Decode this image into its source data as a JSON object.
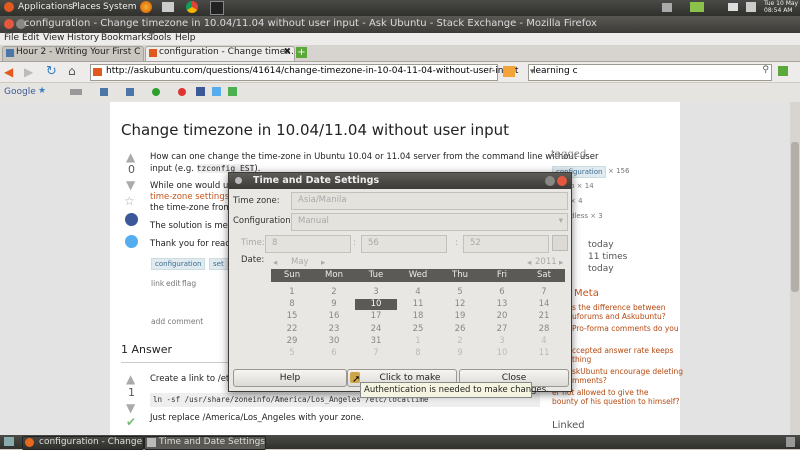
{
  "top_panel": {
    "applications": "Applications",
    "places": "Places",
    "system": "System",
    "clock_date": "Tue 10 May",
    "clock_time": "08:54 AM"
  },
  "firefox": {
    "title": "configuration - Change timezone in 10.04/11.04 without user input - Ask Ubuntu - Stack Exchange - Mozilla Firefox",
    "menu": [
      "File",
      "Edit",
      "View",
      "History",
      "Bookmarks",
      "Tools",
      "Help"
    ],
    "tabs": [
      {
        "label": "Hour 2 - Writing Your First C ..."
      },
      {
        "label": "configuration - Change time..."
      }
    ],
    "url": "http://askubuntu.com/questions/41614/change-timezone-in-10-04-11-04-without-user-input",
    "search_value": "learning c",
    "toolbar2_google": "Google"
  },
  "question": {
    "title": "Change timezone in 10.04/11.04 without user input",
    "vote_count": "0",
    "body_line1": "How can one change the time-zone in Ubuntu 10.04 or 11.04 server from the command line without user",
    "body_line2_prefix": "input (e.g.",
    "body_code": "tzconfig EST",
    "body_line2_suffix": ").",
    "body_p2_line1": "While one would use",
    "body_p2_link": "time-zone settings f",
    "body_p2_line3": "the time-zone from w",
    "body_p3": "The solution is mean",
    "body_p4": "Thank you for reading",
    "tags": [
      "configuration",
      "set"
    ],
    "actions": [
      "link",
      "edit",
      "flag"
    ],
    "add_comment": "add comment"
  },
  "answers": {
    "heading": "1 Answer",
    "vote_count": "1",
    "text1": "Create a link to /etc/",
    "code": "ln -sf /usr/share/zoneinfo/America/Los_Angeles /etc/localtime",
    "text2": "Just replace /America/Los_Angeles with your zone."
  },
  "sidebar": {
    "tagged": "tagged",
    "tag_counts": [
      "configuration × 156",
      "p × 14",
      "× 4",
      "dless × 3"
    ],
    "asked": "today",
    "viewed": "11 times",
    "active": "today",
    "meta_heading": "Meta",
    "meta_links": [
      "s the difference between",
      "uforums and Askubuntu?",
      "Pro-forma comments do you",
      "ccepted answer rate keeps",
      "thing",
      "skUbuntu encourage deleting",
      "mments?",
      "er not allowed to give the",
      "bounty of his question to himself?"
    ],
    "linked": "Linked"
  },
  "dialog": {
    "title": "Time and Date Settings",
    "timezone_label": "Time zone:",
    "timezone_value": "Asia/Manila",
    "configuration_label": "Configuration:",
    "configuration_value": "Manual",
    "time_label": "Time:",
    "hour": "8",
    "minute": "56",
    "second": "52",
    "date_label": "Date:",
    "month": "May",
    "year": "2011",
    "weekdays": [
      "Sun",
      "Mon",
      "Tue",
      "Wed",
      "Thu",
      "Fri",
      "Sat"
    ],
    "weeks": [
      [
        "1",
        "2",
        "3",
        "4",
        "5",
        "6",
        "7"
      ],
      [
        "8",
        "9",
        "10",
        "11",
        "12",
        "13",
        "14"
      ],
      [
        "15",
        "16",
        "17",
        "18",
        "19",
        "20",
        "21"
      ],
      [
        "22",
        "23",
        "24",
        "25",
        "26",
        "27",
        "28"
      ],
      [
        "29",
        "30",
        "31",
        "1",
        "2",
        "3",
        "4"
      ],
      [
        "5",
        "6",
        "7",
        "8",
        "9",
        "10",
        "11"
      ]
    ],
    "selected_day": "10",
    "help_button": "Help",
    "unlock_button": "Click to make changes",
    "close_button": "Close",
    "tooltip": "Authentication is needed to make changes."
  },
  "taskbar": {
    "items": [
      "configuration - Change...",
      "Time and Date Settings"
    ]
  },
  "colors": {
    "panel": "#3c3b37",
    "link_orange": "#c5541c",
    "selected_day": "#5b5a56"
  }
}
